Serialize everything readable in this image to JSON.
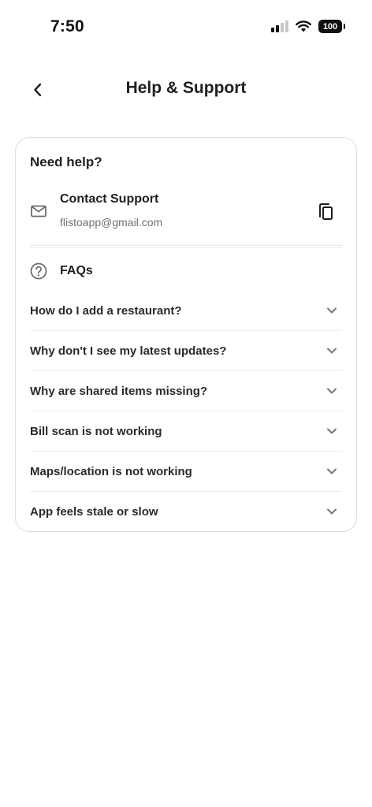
{
  "status_bar": {
    "time": "7:50",
    "battery": "100",
    "signal_bars_active": 2,
    "signal_bars_total": 4
  },
  "header": {
    "title": "Help & Support",
    "back_icon": "chevron-left-icon"
  },
  "card": {
    "heading": "Need help?",
    "contact": {
      "title": "Contact Support",
      "email": "flistoapp@gmail.com",
      "icon": "mail-icon",
      "action_icon": "copy-icon"
    },
    "faqs": {
      "title": "FAQs",
      "icon": "question-circle-icon",
      "items": [
        {
          "question": "How do I add a restaurant?"
        },
        {
          "question": "Why don't I see my latest updates?"
        },
        {
          "question": "Why are shared items missing?"
        },
        {
          "question": "Bill scan is not working"
        },
        {
          "question": "Maps/location is not working"
        },
        {
          "question": "App feels stale or slow"
        }
      ]
    }
  },
  "colors": {
    "text_primary": "#1f1f1f",
    "text_secondary": "#707070",
    "border": "#dcdcdc",
    "icon": "#7a7a7a"
  }
}
